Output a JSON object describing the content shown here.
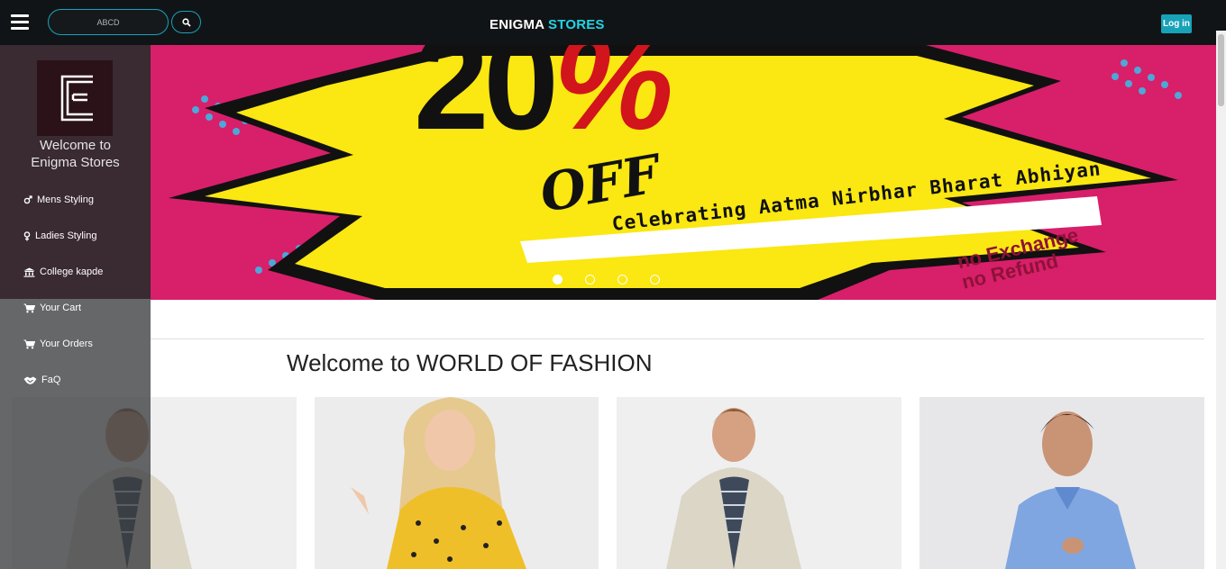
{
  "navbar": {
    "search_placeholder": "ABCD",
    "brand_main": "ENIGMA",
    "brand_accent": "STORES",
    "login_label": "Log in"
  },
  "sidebar": {
    "welcome_line1": "Welcome to",
    "welcome_line2": "Enigma Stores",
    "items": [
      {
        "label": "Mens Styling",
        "icon": "male-icon"
      },
      {
        "label": "Ladies Styling",
        "icon": "female-icon"
      },
      {
        "label": "College kapde",
        "icon": "university-icon"
      },
      {
        "label": "Your Cart",
        "icon": "cart-icon"
      },
      {
        "label": "Your Orders",
        "icon": "cart-icon"
      },
      {
        "label": "FaQ",
        "icon": "handshake-icon"
      }
    ]
  },
  "banner": {
    "headline": "20",
    "percent": "%",
    "off_text": "OFF",
    "tagline": "Celebrating Aatma Nirbhar Bharat Abhiyan",
    "note_line1": "no Exchange",
    "note_line2": "no Refund",
    "slide_count": 4,
    "active_slide": 1
  },
  "main": {
    "title": "Welcome to WORLD OF FASHION",
    "products": [
      {
        "image": "man-in-beige-blazer-photo"
      },
      {
        "image": "woman-in-yellow-polka-dot-top-photo"
      },
      {
        "image": "man-in-beige-blazer-photo"
      },
      {
        "image": "man-in-blue-shirt-photo"
      }
    ]
  },
  "colors": {
    "navbar_bg": "#111416",
    "accent": "#17a2b8",
    "brand_accent": "#22d5e6",
    "banner_yellow": "#fbe711",
    "banner_pink": "#d81f6a"
  }
}
